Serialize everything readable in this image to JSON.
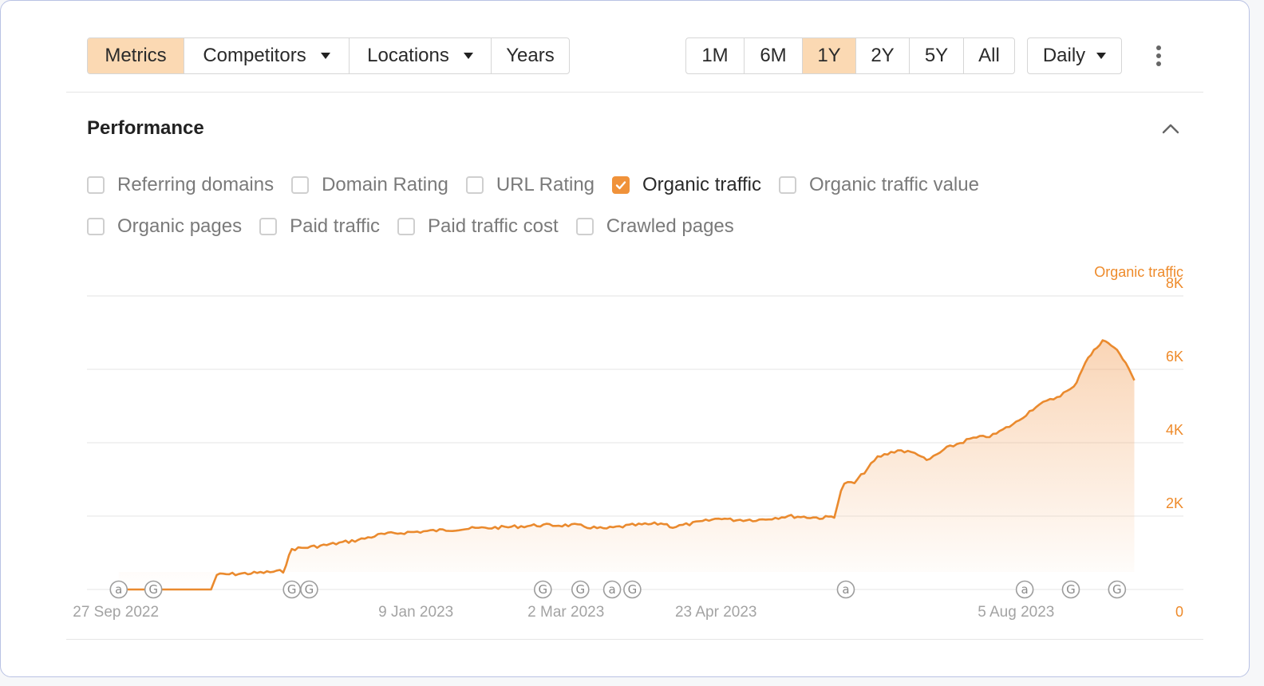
{
  "toolbar": {
    "tabs": [
      {
        "label": "Metrics",
        "active": true,
        "dropdown": false
      },
      {
        "label": "Competitors",
        "active": false,
        "dropdown": true
      },
      {
        "label": "Locations",
        "active": false,
        "dropdown": true
      },
      {
        "label": "Years",
        "active": false,
        "dropdown": false
      }
    ],
    "ranges": [
      {
        "label": "1M",
        "active": false
      },
      {
        "label": "6M",
        "active": false
      },
      {
        "label": "1Y",
        "active": true
      },
      {
        "label": "2Y",
        "active": false
      },
      {
        "label": "5Y",
        "active": false
      },
      {
        "label": "All",
        "active": false
      }
    ],
    "interval_label": "Daily",
    "more_icon": "kebab-vertical-icon"
  },
  "performance": {
    "title": "Performance",
    "collapse_icon": "chevron-up-icon",
    "metrics_row1": [
      {
        "label": "Referring domains",
        "checked": false
      },
      {
        "label": "Domain Rating",
        "checked": false
      },
      {
        "label": "URL Rating",
        "checked": false
      },
      {
        "label": "Organic traffic",
        "checked": true
      },
      {
        "label": "Organic traffic value",
        "checked": false
      }
    ],
    "metrics_row2": [
      {
        "label": "Organic pages",
        "checked": false
      },
      {
        "label": "Paid traffic",
        "checked": false
      },
      {
        "label": "Paid traffic cost",
        "checked": false
      },
      {
        "label": "Crawled pages",
        "checked": false
      }
    ]
  },
  "colors": {
    "accent": "#f0923a",
    "active_bg": "#fbd9b3",
    "series_line": "#ea8a2e",
    "tick_text": "#ee8a2a"
  },
  "chart_data": {
    "type": "area",
    "series_label": "Organic traffic",
    "y_ticks": [
      "0",
      "2K",
      "4K",
      "6K",
      "8K"
    ],
    "ylim": [
      0,
      8000
    ],
    "x_ticks": [
      "27 Sep 2022",
      "9 Jan 2023",
      "2 Mar 2023",
      "23 Apr 2023",
      "5 Aug 2023"
    ],
    "x_tick_dates": [
      "2022-09-27",
      "2023-01-09",
      "2023-03-02",
      "2023-04-23",
      "2023-08-05"
    ],
    "xlim": [
      "2022-09-17",
      "2023-10-02"
    ],
    "grid": true,
    "series": [
      {
        "name": "Organic traffic",
        "x": [
          "2022-09-28",
          "2022-10-10",
          "2022-10-30",
          "2022-11-01",
          "2022-11-15",
          "2022-11-24",
          "2022-11-27",
          "2022-12-08",
          "2022-12-20",
          "2022-12-28",
          "2023-01-05",
          "2023-01-15",
          "2023-01-25",
          "2023-02-10",
          "2023-02-20",
          "2023-03-05",
          "2023-03-15",
          "2023-03-25",
          "2023-04-05",
          "2023-04-08",
          "2023-04-15",
          "2023-04-25",
          "2023-04-28",
          "2023-05-08",
          "2023-05-18",
          "2023-05-30",
          "2023-06-03",
          "2023-06-10",
          "2023-06-18",
          "2023-06-25",
          "2023-07-02",
          "2023-07-05",
          "2023-07-12",
          "2023-07-20",
          "2023-07-28",
          "2023-08-05",
          "2023-08-12",
          "2023-08-18",
          "2023-08-25",
          "2023-08-29",
          "2023-09-01",
          "2023-09-04",
          "2023-09-08",
          "2023-09-12",
          "2023-09-15"
        ],
        "y": [
          0,
          0,
          0,
          400,
          450,
          500,
          1100,
          1200,
          1350,
          1500,
          1550,
          1600,
          1650,
          1700,
          1750,
          1750,
          1650,
          1750,
          1800,
          1700,
          1800,
          1950,
          1900,
          1900,
          2000,
          1950,
          2000,
          2900,
          3600,
          3800,
          3700,
          3500,
          3850,
          4100,
          4200,
          4550,
          5000,
          5200,
          5500,
          6200,
          6500,
          6800,
          6600,
          6200,
          5700
        ]
      }
    ],
    "event_markers": [
      {
        "symbol": "a",
        "date": "2022-09-28"
      },
      {
        "symbol": "G",
        "date": "2022-10-10"
      },
      {
        "symbol": "G",
        "date": "2022-11-27"
      },
      {
        "symbol": "G",
        "date": "2022-12-03"
      },
      {
        "symbol": "G",
        "date": "2023-02-22"
      },
      {
        "symbol": "G",
        "date": "2023-03-07"
      },
      {
        "symbol": "a",
        "date": "2023-03-18"
      },
      {
        "symbol": "G",
        "date": "2023-03-25"
      },
      {
        "symbol": "a",
        "date": "2023-06-07"
      },
      {
        "symbol": "a",
        "date": "2023-08-08"
      },
      {
        "symbol": "G",
        "date": "2023-08-24"
      },
      {
        "symbol": "G",
        "date": "2023-09-09"
      }
    ]
  }
}
